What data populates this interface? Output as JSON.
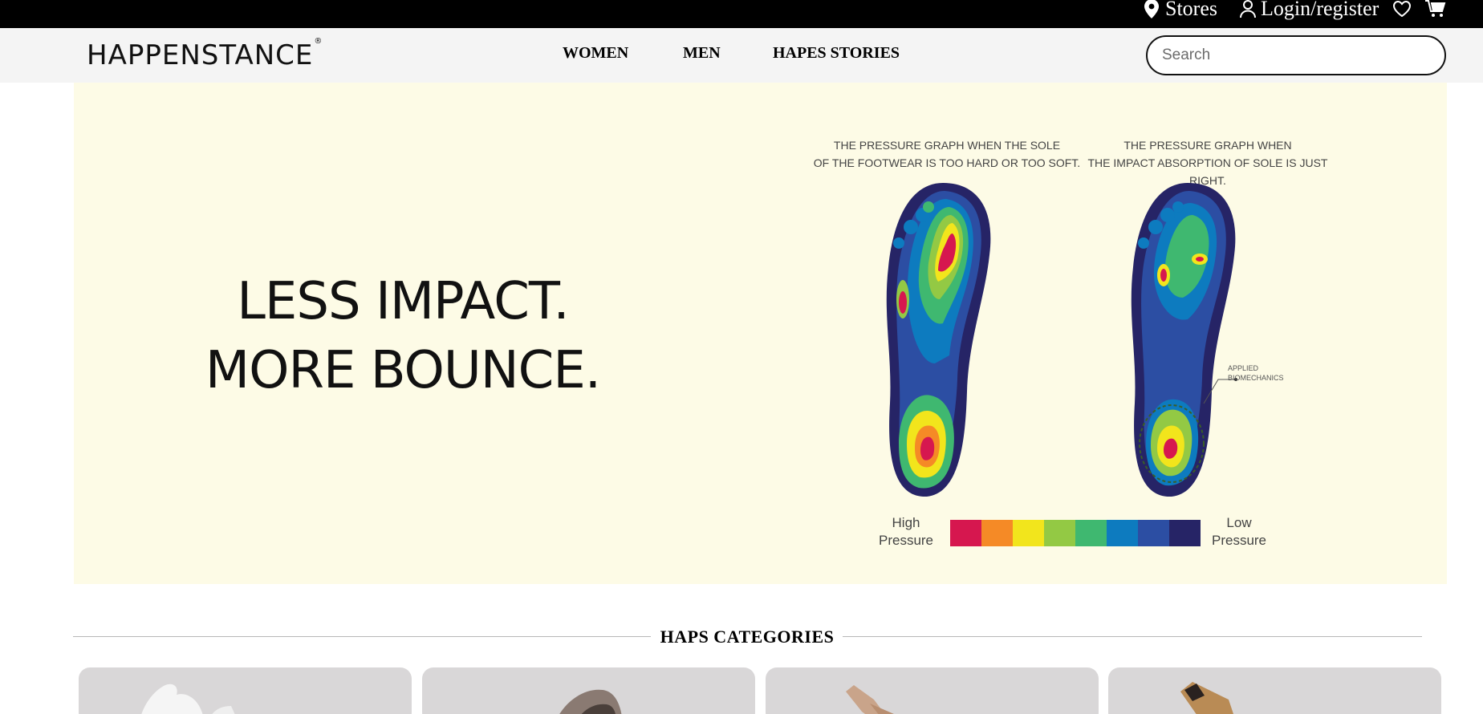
{
  "topbar": {
    "stores_label": "Stores",
    "login_label": "Login/register",
    "icons": [
      "location-pin-icon",
      "user-icon",
      "heart-icon",
      "cart-icon"
    ]
  },
  "header": {
    "logo": "HAPPENSTANCE",
    "logo_mark": "®",
    "nav": [
      "WOMEN",
      "MEN",
      "HAPES STORIES"
    ],
    "search_placeholder": "Search"
  },
  "hero": {
    "line1": "LESS IMPACT.",
    "line2": "MORE BOUNCE.",
    "caption_left_1": "THE PRESSURE GRAPH WHEN THE SOLE",
    "caption_left_2": "OF THE FOOTWEAR IS TOO HARD OR TOO SOFT.",
    "caption_right_1": "THE PRESSURE GRAPH WHEN",
    "caption_right_2": "THE IMPACT ABSORPTION OF SOLE IS JUST RIGHT.",
    "annotation_1": "APPLIED",
    "annotation_2": "BIOMECHANICS",
    "legend_high_1": "High",
    "legend_high_2": "Pressure",
    "legend_low_1": "Low",
    "legend_low_2": "Pressure",
    "scale_colors": [
      "#d6174f",
      "#f58a26",
      "#f2e51c",
      "#93c944",
      "#3fb870",
      "#0d7bbf",
      "#2c4ea3",
      "#262466"
    ]
  },
  "categories": {
    "title": "HAPS CATEGORIES"
  },
  "colors": {
    "topbar_bg": "#000000",
    "header_bg": "#f4f4f4",
    "hero_bg": "#fdfbe6",
    "card_bg": "#d9d7d8"
  }
}
